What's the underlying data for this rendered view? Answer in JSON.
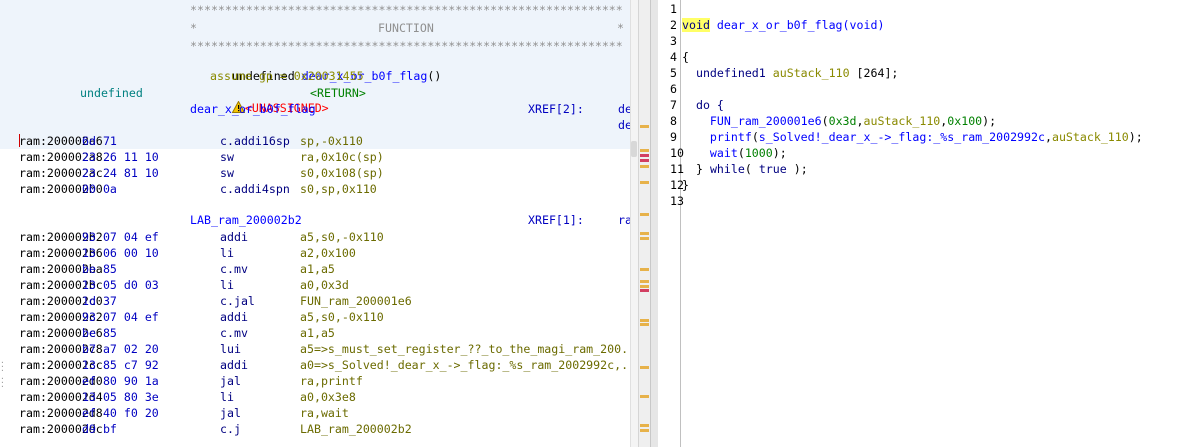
{
  "listing": {
    "header": {
      "stars_top": "**************************************************************",
      "func_line_left": "*",
      "func_title": "FUNCTION",
      "func_line_right": "*",
      "stars_bottom": "**************************************************************",
      "sig_ret": "undefined ",
      "sig_name": "dear_x_or_b0f_flag",
      "sig_params": "()",
      "assume": "assume gp = 0x20031455",
      "ret_type": "undefined",
      "unassigned": "<UNASSIGNED>",
      "return_tag": "<RETURN>",
      "label": "dear_x_or_b0f_flag",
      "xref": "XREF[2]:",
      "xref_right1": "de",
      "xref_right2": "de"
    },
    "rows1": [
      {
        "addr": "ram:200002a6",
        "bytes": "6d 71",
        "mnem": "c.addi16sp",
        "ops": "sp,-0x110"
      },
      {
        "addr": "ram:200002a8",
        "bytes": "23 26 11 10",
        "mnem": "sw",
        "ops": "ra,0x10c(sp)"
      },
      {
        "addr": "ram:200002ac",
        "bytes": "23 24 81 10",
        "mnem": "sw",
        "ops": "s0,0x108(sp)"
      },
      {
        "addr": "ram:200002b0",
        "bytes": "00 0a",
        "mnem": "c.addi4spn",
        "ops": "s0,sp,0x110"
      }
    ],
    "lab": {
      "name": "LAB_ram_200002b2",
      "xref": "XREF[1]:",
      "right": "ra"
    },
    "rows2": [
      {
        "addr": "ram:200002b2",
        "bytes": "93 07 04 ef",
        "mnem": "addi",
        "ops": "a5,s0,-0x110"
      },
      {
        "addr": "ram:200002b6",
        "bytes": "13 06 00 10",
        "mnem": "li",
        "ops": "a2,0x100"
      },
      {
        "addr": "ram:200002ba",
        "bytes": "be 85",
        "mnem": "c.mv",
        "ops": "a1,a5"
      },
      {
        "addr": "ram:200002bc",
        "bytes": "13 05 d0 03",
        "mnem": "li",
        "ops": "a0,0x3d"
      },
      {
        "addr": "ram:200002c0",
        "bytes": "1d 37",
        "mnem": "c.jal",
        "ops": "FUN_ram_200001e6"
      },
      {
        "addr": "ram:200002c2",
        "bytes": "93 07 04 ef",
        "mnem": "addi",
        "ops": "a5,s0,-0x110"
      },
      {
        "addr": "ram:200002c6",
        "bytes": "be 85",
        "mnem": "c.mv",
        "ops": "a1,a5"
      },
      {
        "addr": "ram:200002c8",
        "bytes": "b7 a7 02 20",
        "mnem": "lui",
        "ops": "a5=>s_must_set_register_??_to_the_magi_ram_200..."
      },
      {
        "addr": "ram:200002cc",
        "bytes": "13 85 c7 92",
        "mnem": "addi",
        "ops": "a0=>s_Solved!_dear_x_->_flag:_%s_ram_2002992c,..."
      },
      {
        "addr": "ram:200002d0",
        "bytes": "ef 80 90 1a",
        "mnem": "jal",
        "ops": "ra,printf"
      },
      {
        "addr": "ram:200002d4",
        "bytes": "13 05 80 3e",
        "mnem": "li",
        "ops": "a0,0x3e8"
      },
      {
        "addr": "ram:200002d8",
        "bytes": "ef 40 f0 20",
        "mnem": "jal",
        "ops": "ra,wait"
      },
      {
        "addr": "ram:200002dc",
        "bytes": "d9 bf",
        "mnem": "c.j",
        "ops": "LAB_ram_200002b2"
      }
    ]
  },
  "decompiler": {
    "line_numbers": [
      "1",
      "2",
      "3",
      "4",
      "5",
      "6",
      "7",
      "8",
      "9",
      "10",
      "11",
      "12",
      "13"
    ],
    "l2_void": "void",
    "l2_rest": " dear_x_or_b0f_flag(void)",
    "l4": "{",
    "l5_type": "undefined1",
    "l5_var": "auStack_110",
    "l5_rest": " [264];",
    "l7_do": "do {",
    "l8_fn": "FUN_ram_200001e6",
    "l8_a": "(",
    "l8_n1": "0x3d",
    "l8_b": ",",
    "l8_var": "auStack_110",
    "l8_c": ",",
    "l8_n2": "0x100",
    "l8_d": ");",
    "l9_fn": "printf",
    "l9_a": "(",
    "l9_str": "s_Solved!_dear_x_->_flag:_%s_ram_2002992c",
    "l9_b": ",",
    "l9_var": "auStack_110",
    "l9_c": ");",
    "l10_fn": "wait",
    "l10_a": "(",
    "l10_n": "1000",
    "l10_b": ");",
    "l11_a": "} ",
    "l11_kw": "while",
    "l11_b": "( ",
    "l11_true": "true",
    "l11_c": " );",
    "l12": "}"
  },
  "colors": {
    "header_bg": "#eef4fb",
    "marker_orange": "#e7b24a",
    "marker_pink": "#d23f62",
    "void_highlight": "#ffff66"
  }
}
